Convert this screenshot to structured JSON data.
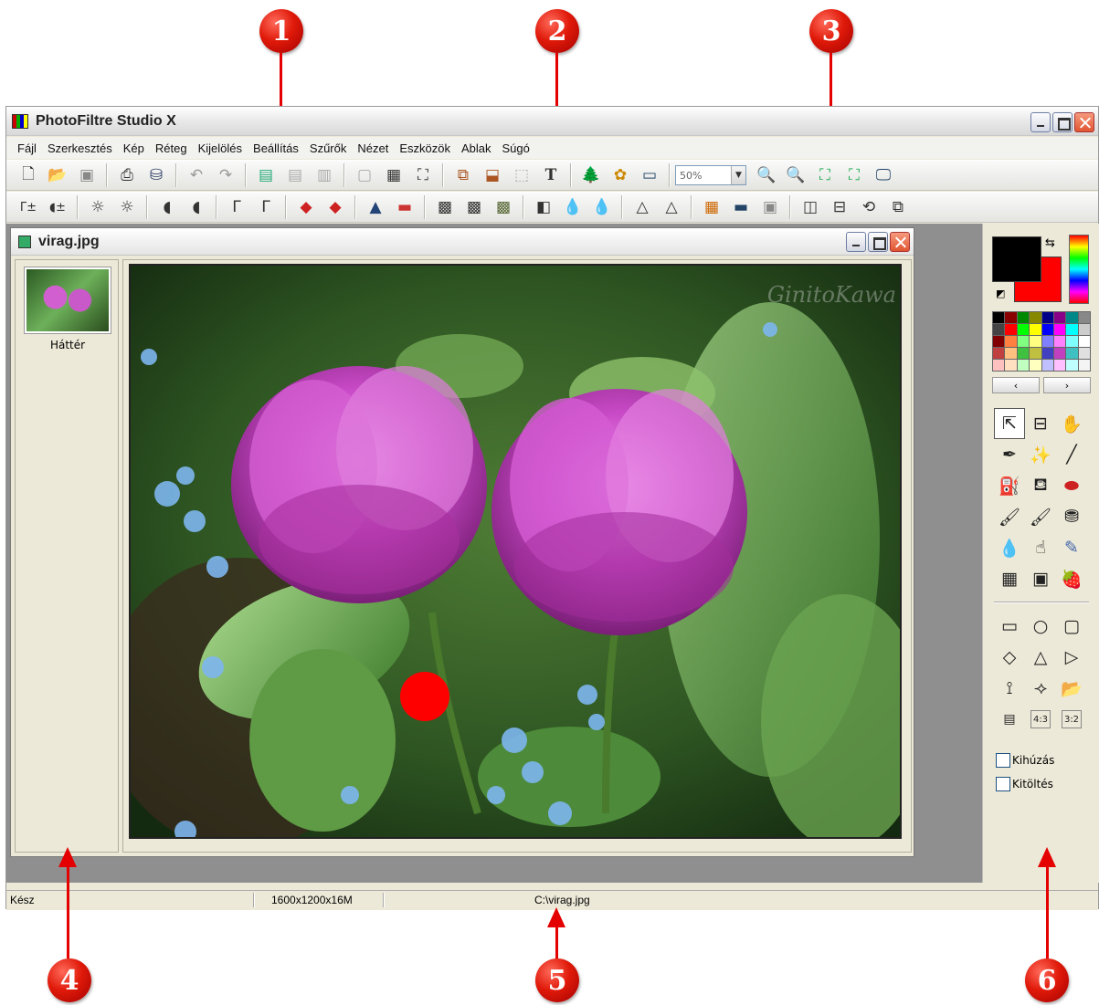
{
  "window": {
    "title": "PhotoFiltre Studio X"
  },
  "menu": [
    "Fájl",
    "Szerkesztés",
    "Kép",
    "Réteg",
    "Kijelölés",
    "Beállítás",
    "Szűrők",
    "Nézet",
    "Eszközök",
    "Ablak",
    "Súgó"
  ],
  "toolbar": {
    "zoom_value": "50%"
  },
  "document": {
    "title": "virag.jpg",
    "layer_name": "Háttér",
    "watermark": "GinitoKawa"
  },
  "options": {
    "stroke_label": "Kihúzás",
    "fill_label": "Kitöltés"
  },
  "status": {
    "state": "Kész",
    "image_info": "1600x1200x16M",
    "path": "C:\\virag.jpg"
  },
  "callouts": [
    "1",
    "2",
    "3",
    "4",
    "5",
    "6"
  ],
  "colors": {
    "foreground": "#000000",
    "background": "#ff0000",
    "callout_red": "#e40000"
  },
  "icons": {
    "toolbar1": [
      "new-icon",
      "open-icon",
      "save-icon",
      "print-icon",
      "scan-icon",
      "undo-icon",
      "redo-icon",
      "paste-layer-icon",
      "copy-layer-icon",
      "merge-icon",
      "image-icon",
      "film-icon",
      "select-icon",
      "copy-icon",
      "crop-icon",
      "text-icon",
      "tree-icon",
      "plugin-icon",
      "window-icon",
      "zoom-in-icon",
      "zoom-out-icon",
      "fit-icon",
      "fullsize-icon",
      "fullscreen-icon"
    ],
    "toolbar2": [
      "auto-levels-icon",
      "auto-contrast-icon",
      "brightness-minus-icon",
      "brightness-plus-icon",
      "contrast-minus-icon",
      "contrast-plus-icon",
      "gamma-minus-icon",
      "gamma-plus-icon",
      "saturation-minus-icon",
      "saturation-plus-icon",
      "histogram-icon",
      "gradient-icon",
      "filter-a-icon",
      "filter-b-icon",
      "filter-c-icon",
      "filter-d-icon",
      "drop-icon",
      "drop-plus-icon",
      "sharpen-icon",
      "sharpen-plus-icon",
      "color-balance-icon",
      "monitor-icon",
      "mask-icon",
      "mirror-icon",
      "flip-icon",
      "rotate-icon",
      "transform-icon"
    ],
    "tools": [
      "pointer-icon",
      "selection-icon",
      "hand-icon",
      "eyedropper-icon",
      "magic-wand-icon",
      "line-icon",
      "fill-icon",
      "spray-icon",
      "eraser-icon",
      "brush-icon",
      "advanced-brush-icon",
      "stamp-icon",
      "blur-icon",
      "smudge-icon",
      "clone-icon",
      "pattern-icon",
      "portrait-icon",
      "strawberry-icon"
    ],
    "shapes": [
      "rectangle-icon",
      "ellipse-icon",
      "rounded-rect-icon",
      "diamond-icon",
      "triangle-icon",
      "arrow-shape-icon",
      "lasso-icon",
      "polygon-icon",
      "open-shape-icon",
      "align-icon",
      "ratio-43-icon",
      "ratio-32-icon"
    ]
  }
}
